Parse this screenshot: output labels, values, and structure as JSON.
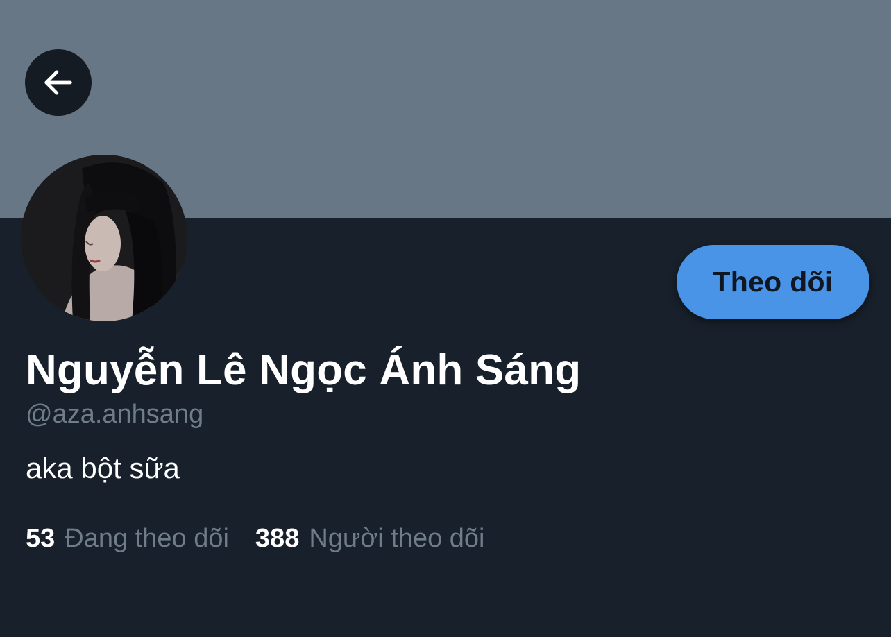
{
  "profile": {
    "display_name": "Nguyễn Lê Ngọc Ánh Sáng",
    "handle": "@aza.anhsang",
    "bio": "aka bột sữa",
    "follow_label": "Theo dõi",
    "banner_color": "#687785",
    "accent_color": "#4a94e8"
  },
  "stats": {
    "following_count": "53",
    "following_label": "Đang theo dõi",
    "followers_count": "388",
    "followers_label": "Người theo dõi"
  },
  "icons": {
    "back": "arrow-left-icon"
  }
}
